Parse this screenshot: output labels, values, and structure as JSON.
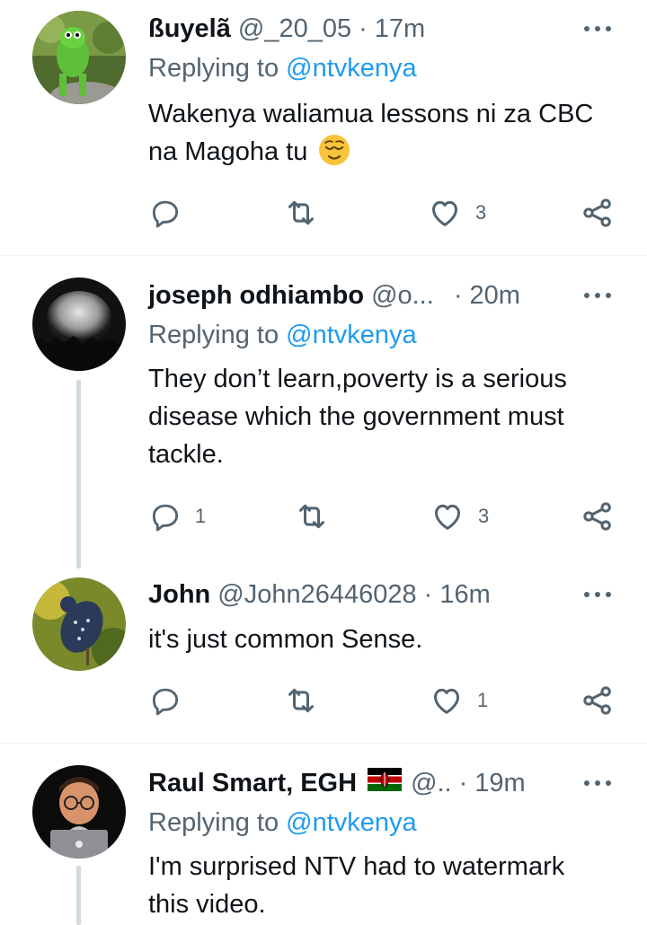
{
  "tweets": [
    {
      "name": "ßuyelã",
      "handle": "@_20_05",
      "dot": "·",
      "time": "17m",
      "replying_prefix": "Replying to ",
      "replying_to": "@ntvkenya",
      "text": "Wakenya waliamua lessons ni za CBC na Magoha tu",
      "emoji": "relieved-face-emoji",
      "replies": "",
      "retweets": "",
      "likes": "3"
    },
    {
      "name": "joseph odhiambo",
      "handle": "@o...",
      "dot": "·",
      "time": "20m",
      "replying_prefix": "Replying to ",
      "replying_to": "@ntvkenya",
      "text": "They don’t learn,poverty is a serious disease  which the government must tackle.",
      "replies": "1",
      "retweets": "",
      "likes": "3"
    },
    {
      "name": "John",
      "handle": "@John26446028",
      "dot": "·",
      "time": "16m",
      "text": "it's just common Sense.",
      "replies": "",
      "retweets": "",
      "likes": "1"
    },
    {
      "name": "Raul Smart, EGH",
      "flag": "kenya-flag-emoji",
      "handle": "@..",
      "dot": "·",
      "time": "19m",
      "replying_prefix": "Replying to ",
      "replying_to": "@ntvkenya",
      "text": "I'm surprised NTV had to watermark this video."
    }
  ],
  "colors": {
    "text": "#0f1419",
    "secondary": "#536471",
    "link": "#1d9bf0",
    "thread_line": "#cfd9de",
    "divider": "#eff3f4"
  }
}
